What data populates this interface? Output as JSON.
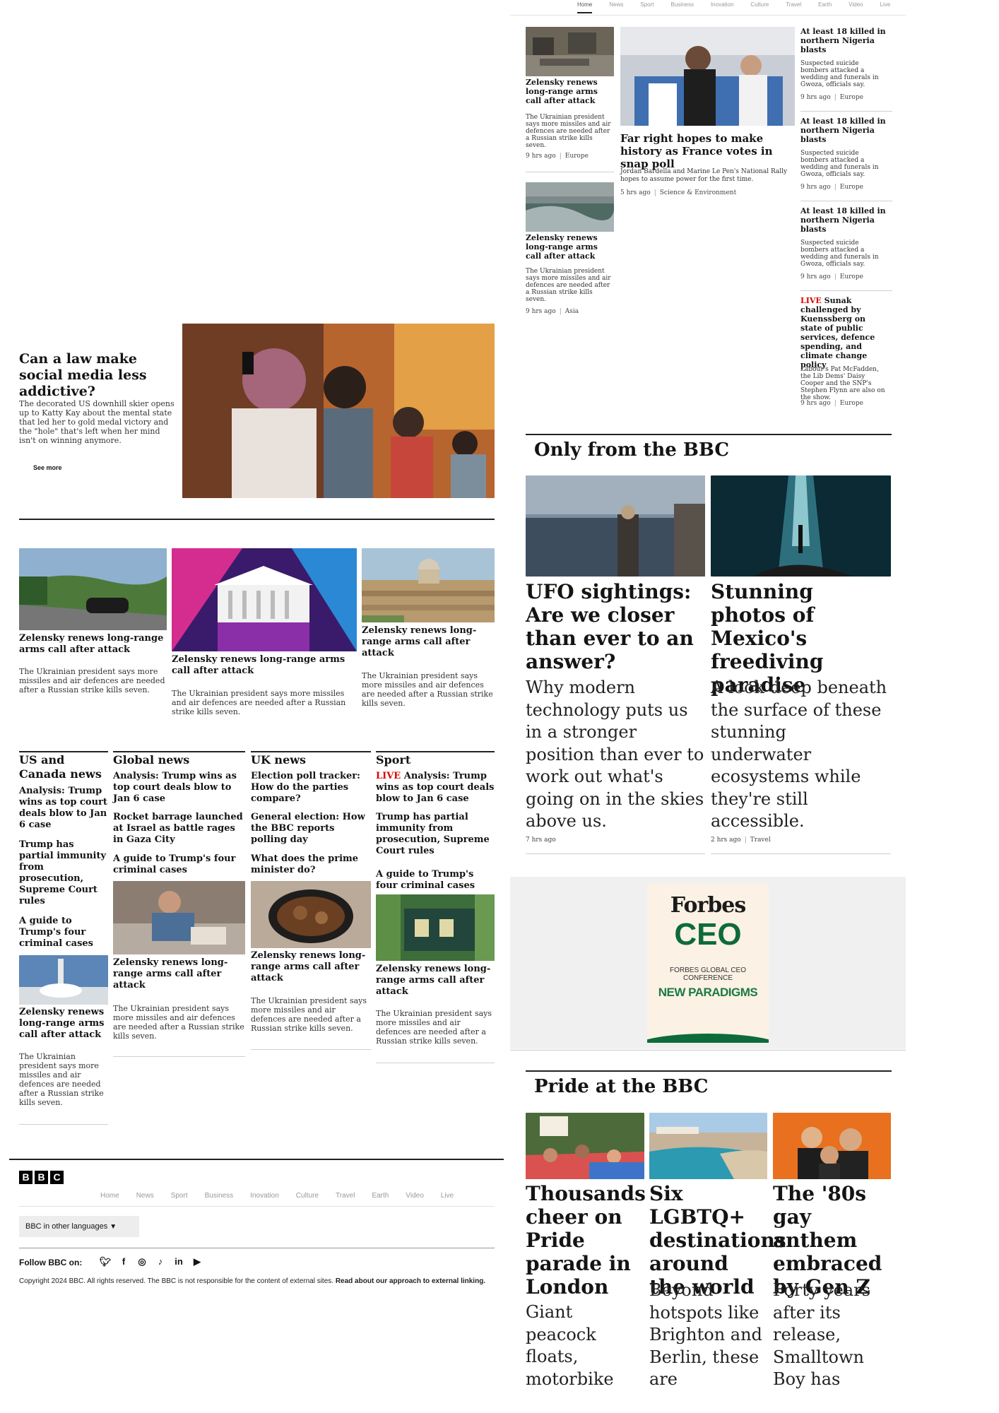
{
  "top_nav": {
    "items": [
      "Home",
      "News",
      "Sport",
      "Business",
      "Inovation",
      "Culture",
      "Travel",
      "Earth",
      "Video",
      "Live"
    ]
  },
  "feature": {
    "title": "Can a law make social media less addictive?",
    "summary": "The decorated US downhill skier opens up to Katty Kay about the mental state that led her to gold medal victory and the \"hole\" that's left when her mind isn't on winning anymore.",
    "link": "See more"
  },
  "top_right": {
    "left_col": [
      {
        "title": "Zelensky renews long-range arms call after attack",
        "summary": "The Ukrainian president says more missiles and air defences are needed after a Russian strike kills seven.",
        "time": "9 hrs ago",
        "section": "Europe"
      },
      {
        "title": "Zelensky renews long-range arms call after attack",
        "summary": "The Ukrainian president says more missiles and air defences are needed after a Russian strike kills seven.",
        "time": "9 hrs ago",
        "section": "Asia"
      }
    ],
    "main": {
      "title": "Far right hopes to make history as France votes in snap poll",
      "summary": "Jordan Bardella and Marine Le Pen's National Rally hopes to assume power for the first time.",
      "time": "5 hrs ago",
      "section": "Science & Environment"
    },
    "right_col": [
      {
        "title": "At least 18 killed in northern Nigeria blasts",
        "summary": "Suspected suicide bombers attacked a wedding and funerals in Gwoza, officials say.",
        "time": "9 hrs ago",
        "section": "Europe"
      },
      {
        "title": "At least 18 killed in northern Nigeria blasts",
        "summary": "Suspected suicide bombers attacked a wedding and funerals in Gwoza, officials say.",
        "time": "9 hrs ago",
        "section": "Europe"
      },
      {
        "title": "At least 18 killed in northern Nigeria blasts",
        "summary": "Suspected suicide bombers attacked a wedding and funerals in Gwoza, officials say.",
        "time": "9 hrs ago",
        "section": "Europe"
      }
    ],
    "live_item": {
      "live": "LIVE",
      "title": "Sunak challenged by Kuenssberg on state of public services, defence spending, and climate change policy",
      "summary": "Labour's Pat McFadden, the Lib Dems' Daisy Cooper and the SNP's Stephen Flynn are also on the show.",
      "time": "9 hrs ago",
      "section": "Europe"
    }
  },
  "three_cards": [
    {
      "title": "Zelensky renews long-range arms call after attack",
      "summary": "The Ukrainian president says more missiles and air defences are needed after a Russian strike kills seven."
    },
    {
      "title": "Zelensky renews long-range arms call after attack",
      "summary": "The Ukrainian president says more missiles and air defences are needed after a Russian strike kills seven."
    },
    {
      "title": "Zelensky renews long-range arms call after attack",
      "summary": "The Ukrainian president says more missiles and air defences are needed after a Russian strike kills seven."
    }
  ],
  "sections": {
    "us": {
      "heading": "US and Canada news",
      "links": [
        "Analysis: Trump wins as top court deals blow to Jan 6 case",
        "Trump has partial immunity from prosecution, Supreme Court rules",
        "A guide to Trump's four criminal cases"
      ],
      "card": {
        "title": "Zelensky renews long-range arms call after attack",
        "summary": "The Ukrainian president says more missiles and air defences are needed after a Russian strike kills seven."
      }
    },
    "global": {
      "heading": "Global news",
      "links": [
        "Analysis: Trump wins as top court deals blow to Jan 6 case",
        "Rocket barrage launched at Israel as battle rages in Gaza City",
        "A guide to Trump's four criminal cases"
      ],
      "card": {
        "title": "Zelensky renews long-range arms call after attack",
        "summary": "The Ukrainian president says more missiles and air defences are needed after a Russian strike kills seven."
      }
    },
    "uk": {
      "heading": "UK news",
      "links": [
        "Election poll tracker: How do the parties compare?",
        "General election: How the BBC reports polling day",
        "What does the prime minister do?"
      ],
      "card": {
        "title": "Zelensky renews long-range arms call after attack",
        "summary": "The Ukrainian president says more missiles and air defences are needed after a Russian strike kills seven."
      }
    },
    "sport": {
      "heading": "Sport",
      "live": "LIVE",
      "links": [
        "Analysis: Trump wins as top court deals blow to Jan 6 case",
        "Trump has partial immunity from prosecution, Supreme Court rules",
        "A guide to Trump's four criminal cases"
      ],
      "card": {
        "title": "Zelensky renews long-range arms call after attack",
        "summary": "The Ukrainian president says more missiles and air defences are needed after a Russian strike kills seven."
      }
    }
  },
  "only_bbc": {
    "heading": "Only from the BBC",
    "items": [
      {
        "title": "UFO sightings: Are we closer than ever to an answer?",
        "summary": "Why modern technology puts us in a stronger position than ever to work out what's going on in the skies above us.",
        "time": "7 hrs ago"
      },
      {
        "title": "Stunning photos of Mexico's freediving paradise",
        "summary": "A look deep beneath the surface of these stunning underwater ecosystems while they're still accessible.",
        "time": "2 hrs ago",
        "section": "Travel"
      }
    ]
  },
  "ad": {
    "brand": "Forbes",
    "word": "CEO",
    "line": "FORBES GLOBAL CEO CONFERENCE",
    "tag": "NEW PARADIGMS"
  },
  "pride": {
    "heading": "Pride at the BBC",
    "items": [
      {
        "title": "Thousands cheer on Pride parade in London",
        "summary": "Giant peacock floats, motorbike"
      },
      {
        "title": "Six LGBTQ+ destinations around the world",
        "summary": "Beyond hotspots like Brighton and Berlin, these are"
      },
      {
        "title": "The '80s gay anthem embraced by Gen Z",
        "summary": "Forty years after its release, Smalltown Boy has"
      }
    ]
  },
  "footer": {
    "logo": [
      "B",
      "B",
      "C"
    ],
    "nav": [
      "Home",
      "News",
      "Sport",
      "Business",
      "Inovation",
      "Culture",
      "Travel",
      "Earth",
      "Video",
      "Live"
    ],
    "languages": "BBC in other languages",
    "follow": "Follow BBC on:",
    "social": [
      "twitter-icon",
      "facebook-icon",
      "instagram-icon",
      "tiktok-icon",
      "linkedin-icon",
      "youtube-icon"
    ],
    "copyright": "Copyright 2024 BBC. All rights reserved. The BBC is not responsible for the content of external sites.",
    "external_link": "Read about our approach to external linking."
  }
}
